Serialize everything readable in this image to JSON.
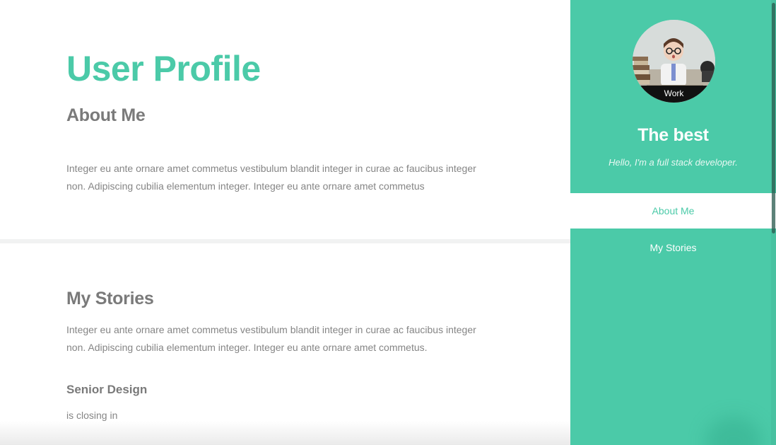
{
  "main": {
    "title": "User Profile",
    "about": {
      "heading": "About Me",
      "text": "Integer eu ante ornare amet commetus vestibulum blandit integer in curae ac faucibus integer non. Adipiscing cubilia elementum integer. Integer eu ante ornare amet commetus"
    },
    "stories": {
      "heading": "My Stories",
      "text": "Integer eu ante ornare amet commetus vestibulum blandit integer in curae ac faucibus integer non. Adipiscing cubilia elementum integer. Integer eu ante ornare amet commetus.",
      "subheading": "Senior Design",
      "subtext": "is closing in"
    }
  },
  "sidebar": {
    "avatar_caption": "Work",
    "name": "The best",
    "tagline": "Hello, I'm a full stack developer.",
    "nav": [
      {
        "label": "About Me",
        "active": true
      },
      {
        "label": "My Stories",
        "active": false
      }
    ]
  },
  "colors": {
    "accent": "#4bcaa8",
    "heading_gray": "#7a7a7a",
    "text_gray": "#858585",
    "divider": "#f1f2f2"
  }
}
